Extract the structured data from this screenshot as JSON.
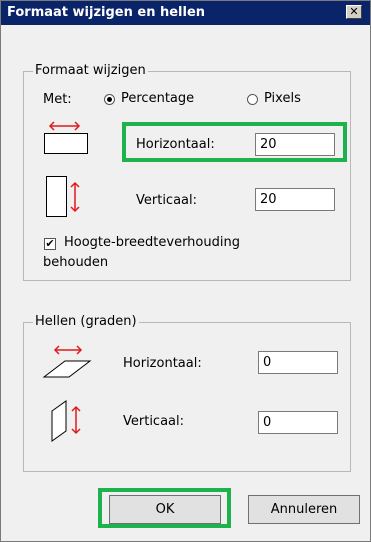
{
  "title": "Formaat wijzigen en hellen",
  "resize": {
    "legend": "Formaat wijzigen",
    "by_label": "Met:",
    "percentage_label": "Percentage",
    "pixels_label": "Pixels",
    "horizontal_label": "Horizontaal:",
    "horizontal_value": "20",
    "vertical_label": "Verticaal:",
    "vertical_value": "20",
    "keep_ratio_line1": "Hoogte-breedteverhouding",
    "keep_ratio_line2": "behouden"
  },
  "skew": {
    "legend": "Hellen (graden)",
    "horizontal_label": "Horizontaal:",
    "horizontal_value": "0",
    "vertical_label": "Verticaal:",
    "vertical_value": "0"
  },
  "buttons": {
    "ok": "OK",
    "cancel": "Annuleren"
  },
  "close_glyph": "✕",
  "checkmark": "✔",
  "colors": {
    "highlight": "#1db24b",
    "arrow": "#e0191b",
    "titlebar": "#0a246a"
  }
}
